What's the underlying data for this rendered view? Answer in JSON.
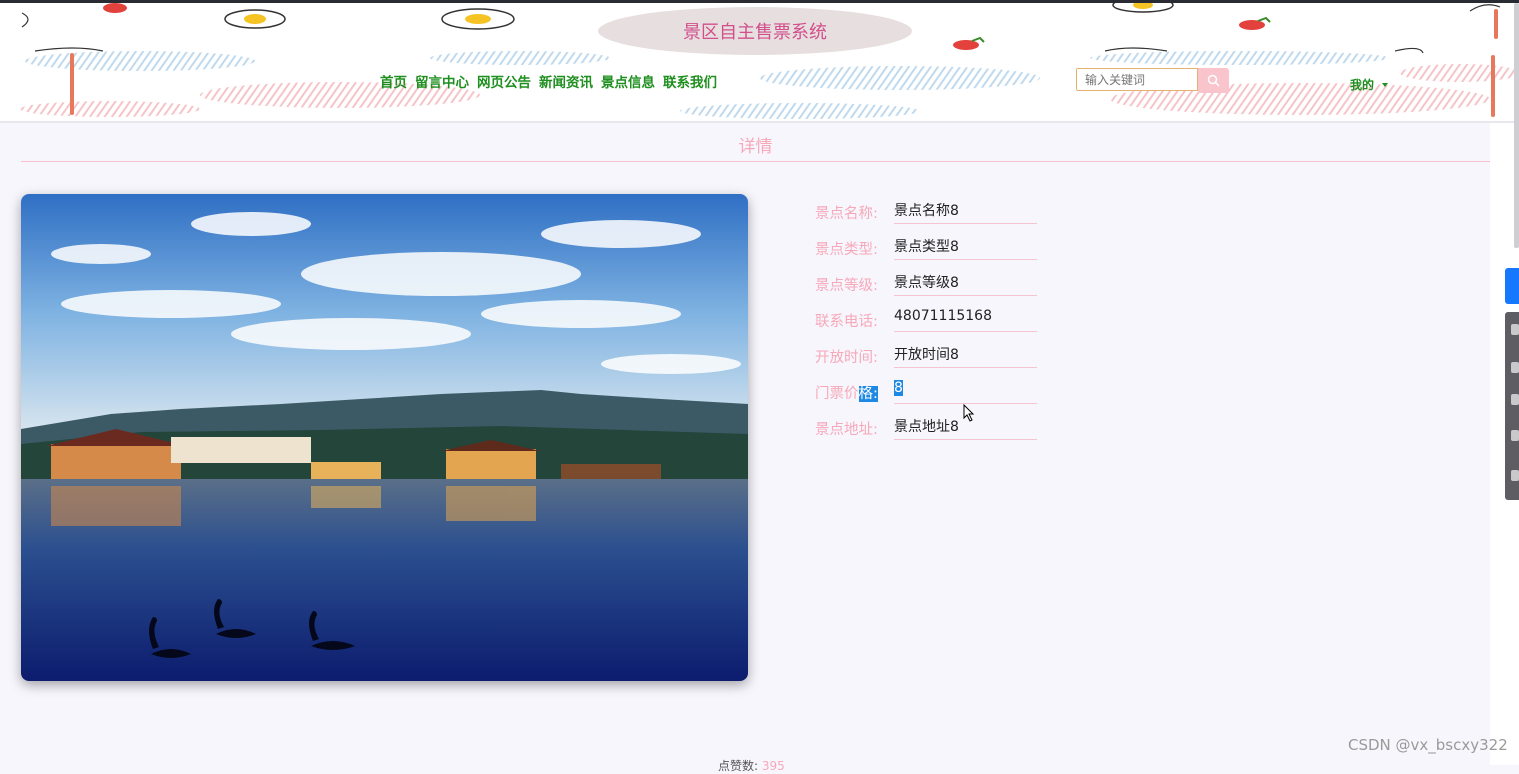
{
  "header": {
    "site_title": "景区自主售票系统",
    "nav": [
      "首页",
      "留言中心",
      "网页公告",
      "新闻资讯",
      "景点信息",
      "联系我们"
    ],
    "search_placeholder": "输入关键词",
    "user_menu_label": "我的"
  },
  "main": {
    "section_title": "详情",
    "photo": "lake-with-swans-and-mountains-photo",
    "details": [
      {
        "label": "景点名称:",
        "value": "景点名称8"
      },
      {
        "label": "景点类型:",
        "value": "景点类型8"
      },
      {
        "label": "景点等级:",
        "value": "景点等级8"
      },
      {
        "label": "联系电话:",
        "value": "48071115168"
      },
      {
        "label": "开放时间:",
        "value": "开放时间8"
      },
      {
        "label": "门票价格:",
        "label_plain": "门票价",
        "label_selected": "格:",
        "value": "8"
      },
      {
        "label": "景点地址:",
        "value": "景点地址8"
      }
    ],
    "likes_label": "点赞数:",
    "likes_value": "395"
  },
  "watermark": "CSDN @vx_bscxy322",
  "colors": {
    "nav_green": "#1f8f1f",
    "accent_pink": "#f7a8b8",
    "title_pink": "#d24f8b",
    "selection_blue": "#1e88e5"
  },
  "icons": [
    "search-icon",
    "chevron-down-icon",
    "mouse-cursor-icon"
  ]
}
